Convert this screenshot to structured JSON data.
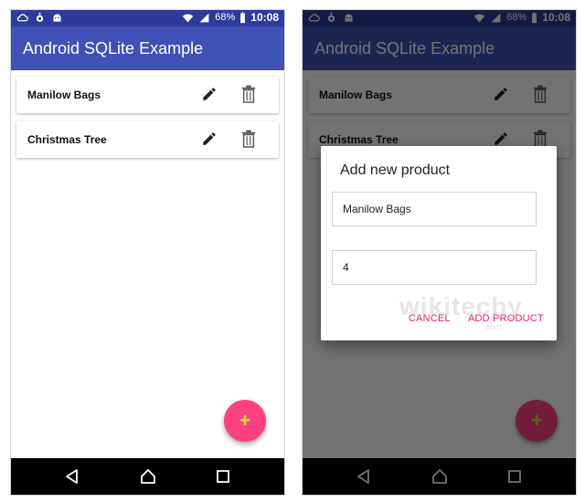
{
  "colors": {
    "primary": "#3f51b5",
    "status_bar": "#2f3b9a",
    "accent": "#ff4081",
    "fab_icon": "#c6e032",
    "dialog_button": "#e91e63"
  },
  "status_bar": {
    "battery": "68%",
    "time": "10:08",
    "icons": [
      "cloud-sync-icon",
      "android-debug-icon",
      "android-icon",
      "wifi-icon",
      "signal-icon",
      "battery-icon"
    ]
  },
  "app": {
    "title": "Android SQLite Example"
  },
  "products": [
    {
      "name": "Manilow Bags"
    },
    {
      "name": "Christmas Tree"
    }
  ],
  "fab": {
    "label": "+"
  },
  "dialog": {
    "title": "Add new product",
    "name_value": "Manilow Bags",
    "quantity_value": "4",
    "cancel_label": "CANCEL",
    "add_label": "ADD PRODUCT"
  },
  "watermark": {
    "brand": "wikitechy",
    "domain": ".com"
  }
}
